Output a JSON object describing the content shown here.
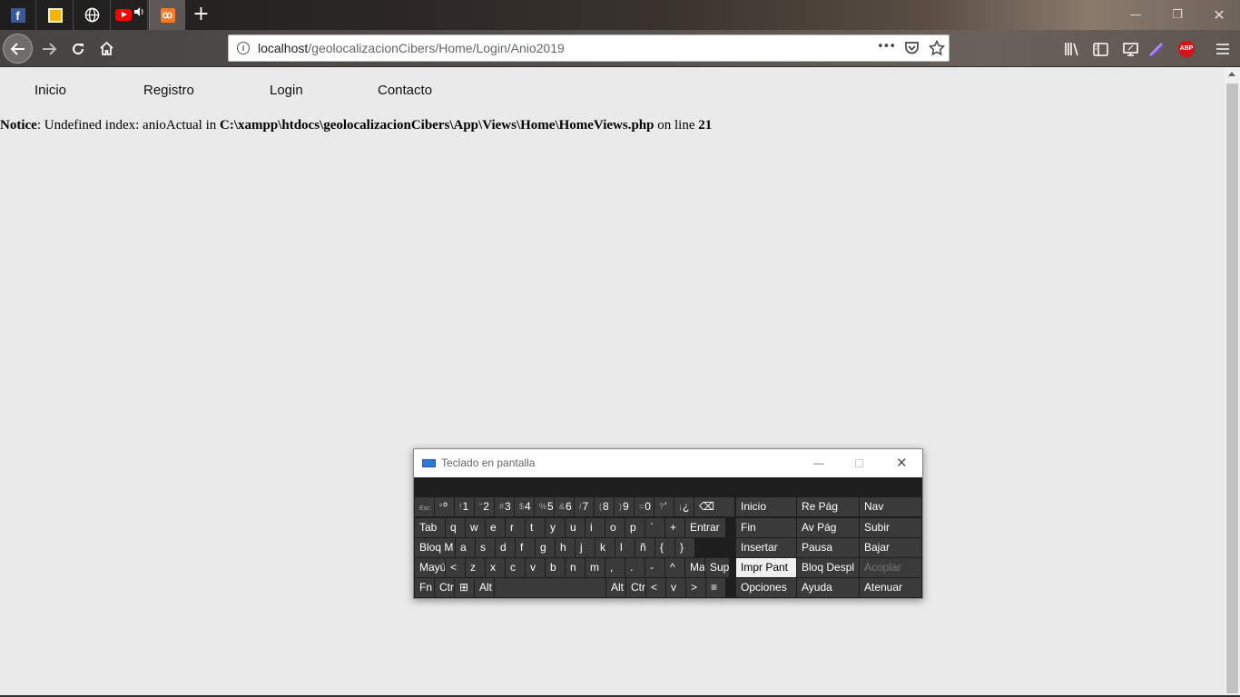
{
  "browser": {
    "tabs": [
      {
        "icon": "facebook-icon",
        "color": "#3b5998"
      },
      {
        "icon": "notes-icon",
        "color": "#f4b400"
      },
      {
        "icon": "globe-icon",
        "color": "#ffffff"
      },
      {
        "icon": "youtube-icon",
        "color": "#ff0000",
        "audio": true
      },
      {
        "icon": "xampp-icon",
        "color": "#fb7a24",
        "active": true
      }
    ],
    "new_tab": "+",
    "url_host": "localhost",
    "url_path": "/geolocalizacionCibers/Home/Login/Anio2019",
    "url_more": "•••",
    "adblock_label": "ABP"
  },
  "site_nav": {
    "items": [
      "Inicio",
      "Registro",
      "Login",
      "Contacto"
    ]
  },
  "notice": {
    "label": "Notice",
    "text1": ": Undefined index: anioActual in ",
    "path": "C:\\xampp\\htdocs\\geolocalizacionCibers\\App\\Views\\Home\\HomeViews.php",
    "text2": " on line ",
    "line": "21"
  },
  "osk": {
    "title": "Teclado en pantalla",
    "row1": [
      {
        "k": "Esc",
        "small": true
      },
      {
        "k": "º",
        "s": "ª"
      },
      {
        "k": "1",
        "s": "!"
      },
      {
        "k": "2",
        "s": "\""
      },
      {
        "k": "3",
        "s": "#"
      },
      {
        "k": "4",
        "s": "$"
      },
      {
        "k": "5",
        "s": "%"
      },
      {
        "k": "6",
        "s": "&"
      },
      {
        "k": "7",
        "s": "/"
      },
      {
        "k": "8",
        "s": "("
      },
      {
        "k": "9",
        "s": ")"
      },
      {
        "k": "0",
        "s": "="
      },
      {
        "k": "'",
        "s": "?"
      },
      {
        "k": "¿",
        "s": "¡"
      },
      {
        "k": "⌫"
      }
    ],
    "row2": [
      "Tab",
      "q",
      "w",
      "e",
      "r",
      "t",
      "y",
      "u",
      "i",
      "o",
      "p",
      "`",
      "+",
      "Entrar"
    ],
    "row3": [
      "Bloq M",
      "a",
      "s",
      "d",
      "f",
      "g",
      "h",
      "j",
      "k",
      "l",
      "ñ",
      "{",
      "}"
    ],
    "row4": [
      "Mayú",
      "<",
      "z",
      "x",
      "c",
      "v",
      "b",
      "n",
      "m",
      ",",
      ".",
      "-",
      "^",
      "Ma",
      "Supr"
    ],
    "row5": [
      "Fn",
      "Ctr",
      "⊞",
      "Alt",
      "",
      "Alt",
      "Ctr",
      "<",
      "v",
      ">",
      "≡"
    ],
    "nav": [
      [
        "Inicio",
        "Re Pág",
        "Nav"
      ],
      [
        "Fin",
        "Av Pág",
        "Subir"
      ],
      [
        "Insertar",
        "Pausa",
        "Bajar"
      ],
      [
        "Impr Pant",
        "Bloq Despl",
        "Acoplar"
      ],
      [
        "Opciones",
        "Ayuda",
        "Atenuar"
      ]
    ]
  }
}
